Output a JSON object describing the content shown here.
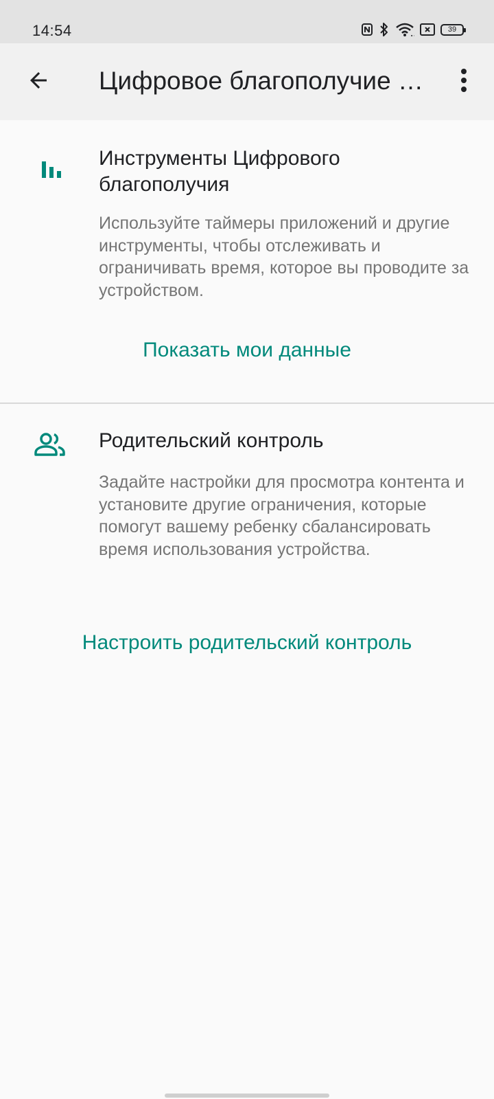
{
  "status_bar": {
    "time": "14:54",
    "battery_level": "39",
    "icons": [
      "nfc-icon",
      "bluetooth-icon",
      "wifi-icon",
      "notification-box-icon",
      "battery-icon"
    ]
  },
  "app_bar": {
    "title": "Цифровое благополучие и родительский контроль",
    "back_icon": "arrow-back-icon",
    "more_icon": "more-vert-icon"
  },
  "sections": [
    {
      "icon": "bar-chart-icon",
      "title": "Инструменты Цифрового благополучия",
      "description": "Используйте таймеры приложений и другие инструменты, чтобы отслеживать и ограничивать время, которое вы проводите за устройством.",
      "action_label": "Показать мои данные"
    },
    {
      "icon": "people-icon",
      "title": "Родительский контроль",
      "description": "Задайте настройки для просмотра контента и установите другие ограничения, которые помогут вашему ребенку сбалансировать время использования устройства.",
      "action_label": "Настроить родительский контроль"
    }
  ],
  "colors": {
    "accent": "#00897b",
    "status_bar": "#e3e3e3",
    "app_bar": "#f1f1f1",
    "background": "#fafafa",
    "secondary_text": "#757575"
  }
}
